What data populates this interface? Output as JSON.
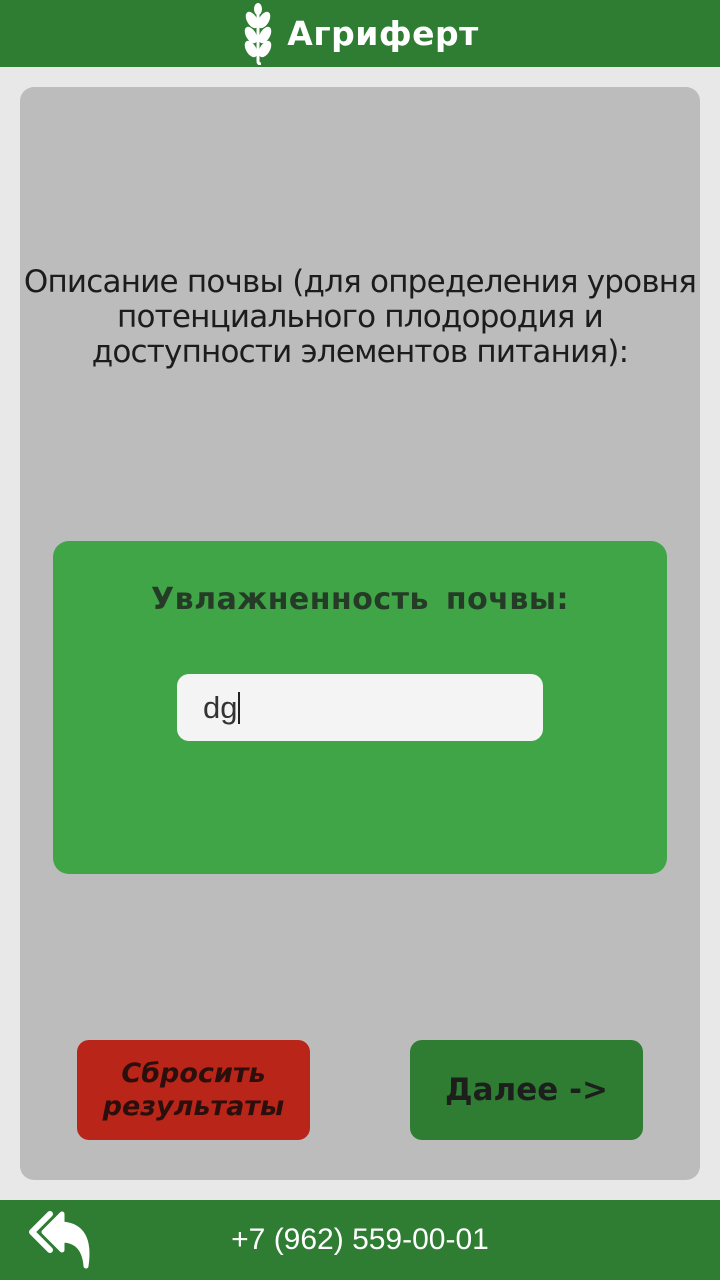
{
  "header": {
    "brand_name": "Агриферт",
    "logo_icon": "wheat-icon"
  },
  "main": {
    "description": "Описание почвы (для определения уровня потенциального плодородия и доступности элементов питания):",
    "card": {
      "title": "Увлажненность  почвы:",
      "input_value": "dg"
    },
    "buttons": {
      "reset_label": "Сбросить результаты",
      "next_label": "Далее ->"
    }
  },
  "footer": {
    "back_icon": "back-arrow-icon",
    "phone": "+7 (962) 559-00-01"
  },
  "colors": {
    "brand_green": "#2e7d32",
    "card_green": "#3fa547",
    "panel_gray": "#bcbcbc",
    "reset_red": "#b92518"
  }
}
